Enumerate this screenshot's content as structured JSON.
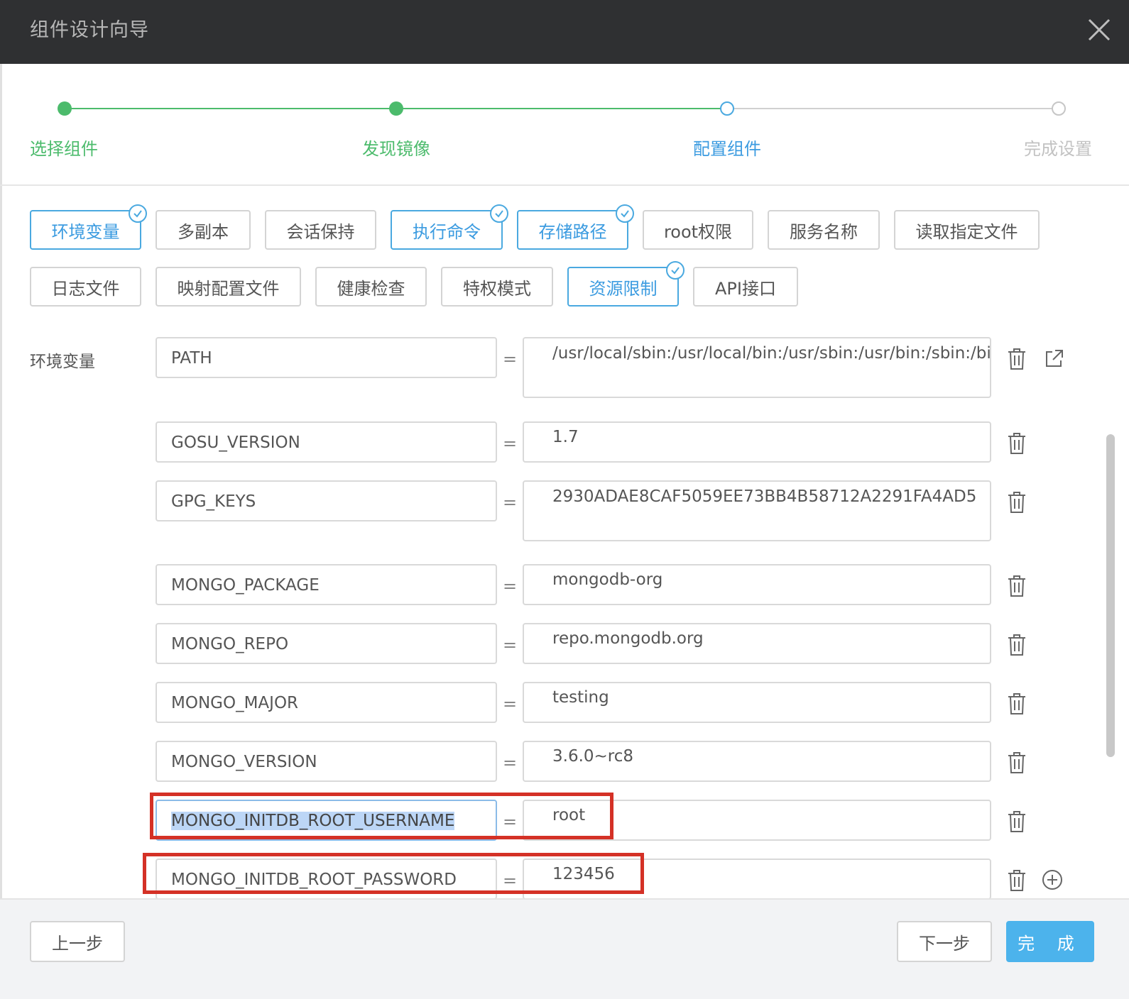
{
  "dialog": {
    "title": "组件设计向导"
  },
  "steps": [
    {
      "label": "选择组件",
      "state": "done"
    },
    {
      "label": "发现镜像",
      "state": "done"
    },
    {
      "label": "配置组件",
      "state": "current"
    },
    {
      "label": "完成设置",
      "state": "todo"
    }
  ],
  "tabs": [
    {
      "label": "环境变量",
      "active": true,
      "checked": true
    },
    {
      "label": "多副本",
      "active": false,
      "checked": false
    },
    {
      "label": "会话保持",
      "active": false,
      "checked": false
    },
    {
      "label": "执行命令",
      "active": true,
      "checked": true
    },
    {
      "label": "存储路径",
      "active": true,
      "checked": true
    },
    {
      "label": "root权限",
      "active": false,
      "checked": false
    },
    {
      "label": "服务名称",
      "active": false,
      "checked": false
    },
    {
      "label": "读取指定文件",
      "active": false,
      "checked": false
    },
    {
      "label": "日志文件",
      "active": false,
      "checked": false
    },
    {
      "label": "映射配置文件",
      "active": false,
      "checked": false
    },
    {
      "label": "健康检查",
      "active": false,
      "checked": false
    },
    {
      "label": "特权模式",
      "active": false,
      "checked": false
    },
    {
      "label": "资源限制",
      "active": true,
      "checked": true
    },
    {
      "label": "API接口",
      "active": false,
      "checked": false
    }
  ],
  "env": {
    "label": "环境变量",
    "equals": "=",
    "rows": [
      {
        "key": "PATH",
        "value": "/usr/local/sbin:/usr/local/bin:/usr/sbin:/usr/bin:/sbin:/bin"
      },
      {
        "key": "GOSU_VERSION",
        "value": "1.7"
      },
      {
        "key": "GPG_KEYS",
        "value": "2930ADAE8CAF5059EE73BB4B58712A2291FA4AD5"
      },
      {
        "key": "MONGO_PACKAGE",
        "value": "mongodb-org"
      },
      {
        "key": "MONGO_REPO",
        "value": "repo.mongodb.org"
      },
      {
        "key": "MONGO_MAJOR",
        "value": "testing"
      },
      {
        "key": "MONGO_VERSION",
        "value": "3.6.0~rc8"
      },
      {
        "key": "MONGO_INITDB_ROOT_USERNAME",
        "value": "root"
      },
      {
        "key": "MONGO_INITDB_ROOT_PASSWORD",
        "value": "123456"
      }
    ]
  },
  "footer": {
    "prev": "上一步",
    "next": "下一步",
    "finish": "完 成"
  },
  "colors": {
    "accent": "#4aa9e0",
    "done": "#4cbb6c",
    "highlight": "#d43126",
    "titlebar": "#2f3032"
  },
  "icons": [
    "close-icon",
    "check-icon",
    "trash-icon",
    "external-link-icon",
    "add-circle-icon"
  ]
}
